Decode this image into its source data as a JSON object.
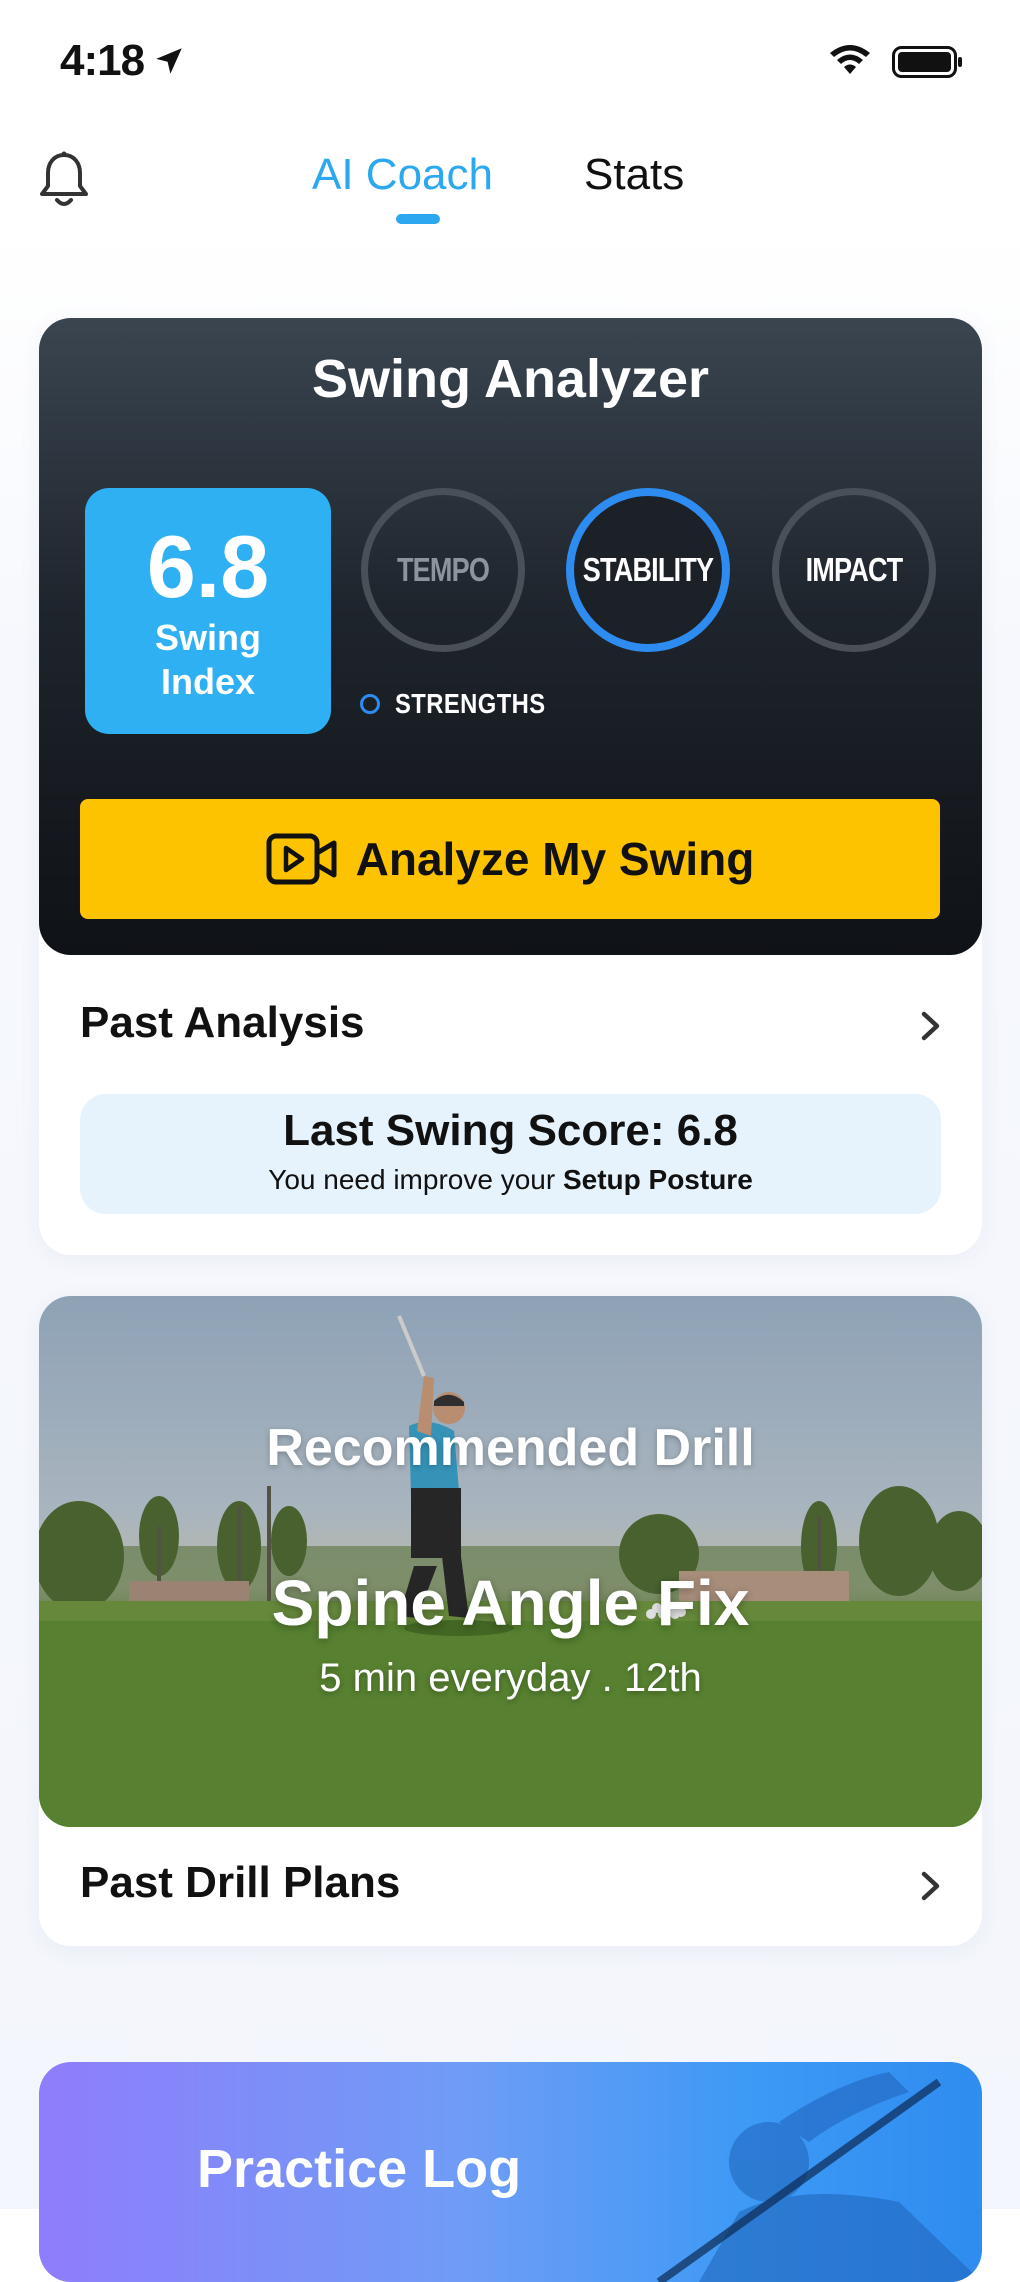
{
  "status_bar": {
    "time": "4:18"
  },
  "header": {
    "tabs": [
      {
        "label": "AI Coach",
        "active": true
      },
      {
        "label": "Stats",
        "active": false
      }
    ]
  },
  "swing_analyzer": {
    "title": "Swing Analyzer",
    "index_value": "6.8",
    "index_label": "Swing Index",
    "metrics": [
      {
        "label": "TEMPO",
        "highlighted": false
      },
      {
        "label": "STABILITY",
        "highlighted": true
      },
      {
        "label": "IMPACT",
        "highlighted": false
      }
    ],
    "legend": "STRENGTHS",
    "analyze_button": "Analyze My Swing"
  },
  "past_analysis": {
    "title": "Past Analysis",
    "score_title": "Last Swing Score: 6.8",
    "score_prefix": "You need improve your ",
    "score_focus": "Setup Posture"
  },
  "drill": {
    "heading": "Recommended Drill",
    "name": "Spine Angle Fix",
    "meta": "5 min everyday  .  12th",
    "past_plans": "Past Drill Plans"
  },
  "practice_log": {
    "title": "Practice Log"
  },
  "colors": {
    "accent": "#2ba8ef",
    "button": "#fdc300",
    "stability_ring": "#2e8cf0",
    "index_box": "#2eb0f3"
  }
}
